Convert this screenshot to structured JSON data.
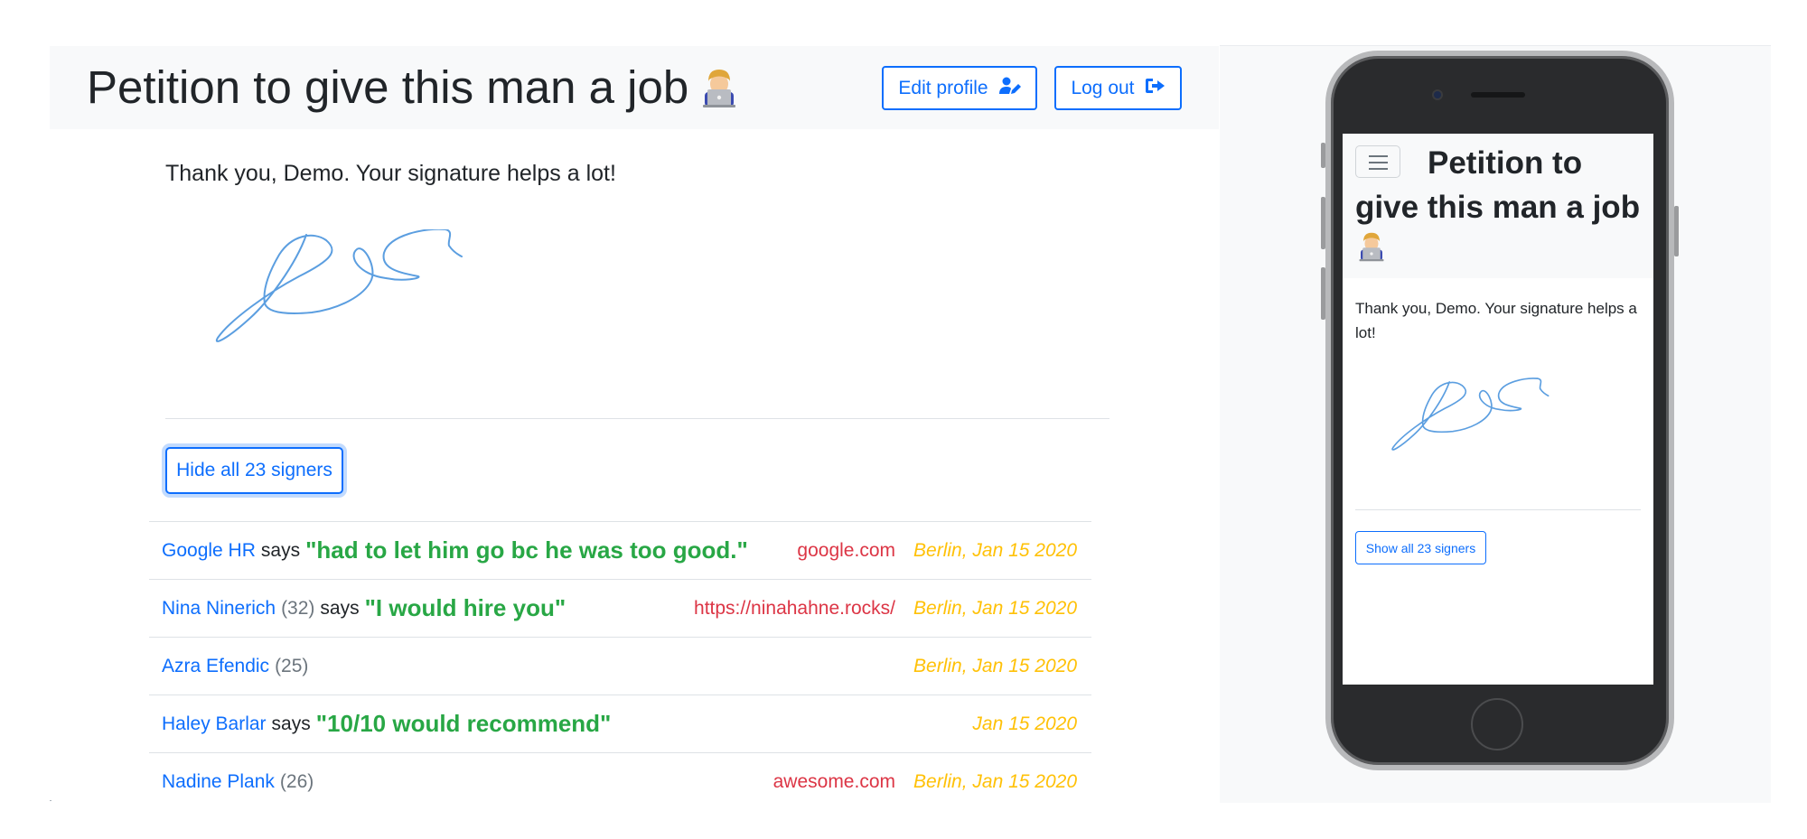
{
  "desktop": {
    "title": "Petition to give this man a job",
    "title_emoji_icon": "technologist-emoji-icon",
    "edit_profile_label": "Edit profile",
    "edit_profile_icon": "user-edit-icon",
    "log_out_label": "Log out",
    "log_out_icon": "sign-out-icon",
    "thank_you": "Thank you, Demo. Your signature helps a lot!",
    "toggle_signers_label": "Hide all 23 signers",
    "signers": [
      {
        "name": "Google HR",
        "age": "",
        "says": "says",
        "quote": "\"had to let him go bc he was too good.\"",
        "website": "google.com",
        "when": "Berlin, Jan 15 2020"
      },
      {
        "name": "Nina Ninerich",
        "age": "(32)",
        "says": "says",
        "quote": "\"I would hire you\"",
        "website": "https://ninahahne.rocks/",
        "when": "Berlin, Jan 15 2020"
      },
      {
        "name": "Azra Efendic",
        "age": "(25)",
        "says": "",
        "quote": "",
        "website": "",
        "when": "Berlin, Jan 15 2020"
      },
      {
        "name": "Haley Barlar",
        "age": "",
        "says": "says",
        "quote": "\"10/10 would recommend\"",
        "website": "",
        "when": "Jan 15 2020"
      },
      {
        "name": "Nadine Plank",
        "age": "(26)",
        "says": "",
        "quote": "",
        "website": "awesome.com",
        "when": "Berlin, Jan 15 2020"
      }
    ]
  },
  "mobile": {
    "title": "Petition to give this man a job",
    "menu_icon": "hamburger-menu-icon",
    "thank_you": "Thank you, Demo. Your signature helps a lot!",
    "toggle_signers_label": "Show all 23 signers"
  },
  "colors": {
    "primary": "#0d6efd",
    "quote": "#28a745",
    "website": "#dc3545",
    "date": "#ffc107",
    "header_bg": "#f8f9fa"
  }
}
